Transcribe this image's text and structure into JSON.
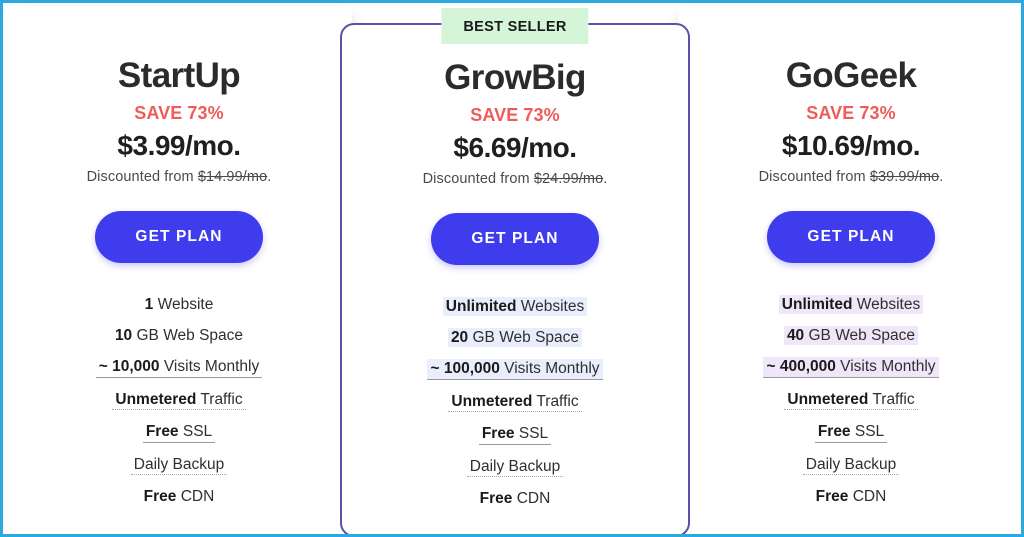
{
  "theme": {
    "frame_color": "#29abe2",
    "cta_color": "#3f3ced",
    "save_color": "#ef5b5b",
    "featured_border": "#5b52a8",
    "badge_bg": "#d5f5d9",
    "highlight_blue": "#e8eefb",
    "highlight_purple": "#efe6fa"
  },
  "featured_badge": "BEST SELLER",
  "plans": [
    {
      "name": "StartUp",
      "save": "SAVE 73%",
      "price": "$3.99/mo.",
      "discount_prefix": "Discounted from ",
      "discount_old": "$14.99/mo",
      "discount_suffix": ".",
      "cta": "GET PLAN",
      "features": [
        {
          "strong": "1",
          "rest": " Website",
          "underline": "none",
          "highlight": "none"
        },
        {
          "strong": "10",
          "rest": " GB Web Space",
          "underline": "none",
          "highlight": "none"
        },
        {
          "strong": "~ 10,000",
          "rest": " Visits Monthly",
          "underline": "solid",
          "highlight": "none"
        },
        {
          "strong": "Unmetered",
          "rest": " Traffic",
          "underline": "dotted",
          "highlight": "none"
        },
        {
          "strong": "Free",
          "rest": " SSL",
          "underline": "solid",
          "highlight": "none"
        },
        {
          "strong": "",
          "rest": "Daily Backup",
          "underline": "dotted",
          "highlight": "none"
        },
        {
          "strong": "Free",
          "rest": " CDN",
          "underline": "none",
          "highlight": "none"
        }
      ]
    },
    {
      "name": "GrowBig",
      "save": "SAVE 73%",
      "price": "$6.69/mo.",
      "discount_prefix": "Discounted from ",
      "discount_old": "$24.99/mo",
      "discount_suffix": ".",
      "cta": "GET PLAN",
      "features": [
        {
          "strong": "Unlimited",
          "rest": " Websites",
          "underline": "none",
          "highlight": "blue"
        },
        {
          "strong": "20",
          "rest": " GB Web Space",
          "underline": "none",
          "highlight": "blue"
        },
        {
          "strong": "~ 100,000",
          "rest": " Visits Monthly",
          "underline": "solid",
          "highlight": "blue"
        },
        {
          "strong": "Unmetered",
          "rest": " Traffic",
          "underline": "dotted",
          "highlight": "none"
        },
        {
          "strong": "Free",
          "rest": " SSL",
          "underline": "solid",
          "highlight": "none"
        },
        {
          "strong": "",
          "rest": "Daily Backup",
          "underline": "dotted",
          "highlight": "none"
        },
        {
          "strong": "Free",
          "rest": " CDN",
          "underline": "none",
          "highlight": "none"
        }
      ]
    },
    {
      "name": "GoGeek",
      "save": "SAVE 73%",
      "price": "$10.69/mo.",
      "discount_prefix": "Discounted from ",
      "discount_old": "$39.99/mo",
      "discount_suffix": ".",
      "cta": "GET PLAN",
      "features": [
        {
          "strong": "Unlimited",
          "rest": " Websites",
          "underline": "none",
          "highlight": "purple"
        },
        {
          "strong": "40",
          "rest": " GB Web Space",
          "underline": "none",
          "highlight": "purple"
        },
        {
          "strong": "~ 400,000",
          "rest": " Visits Monthly",
          "underline": "solid",
          "highlight": "purple"
        },
        {
          "strong": "Unmetered",
          "rest": " Traffic",
          "underline": "dotted",
          "highlight": "none"
        },
        {
          "strong": "Free",
          "rest": " SSL",
          "underline": "solid",
          "highlight": "none"
        },
        {
          "strong": "",
          "rest": "Daily Backup",
          "underline": "dotted",
          "highlight": "none"
        },
        {
          "strong": "Free",
          "rest": " CDN",
          "underline": "none",
          "highlight": "none"
        }
      ]
    }
  ]
}
